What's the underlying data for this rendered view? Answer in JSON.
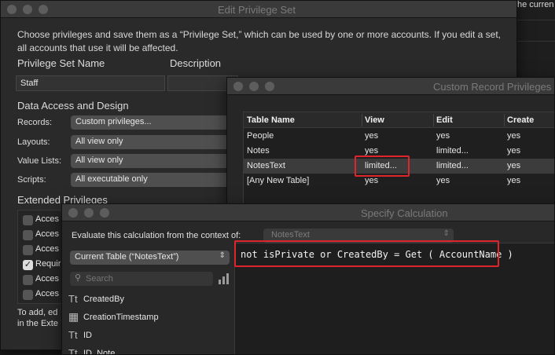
{
  "background": {
    "right_text": "he curren"
  },
  "edit_privilege_set": {
    "title": "Edit Privilege Set",
    "description_text": "Choose privileges and save them as a “Privilege Set,” which can be used by one or more accounts. If you edit a set, all accounts that use it will be affected.",
    "name_label": "Privilege Set Name",
    "name_value": "Staff",
    "description_label": "Description",
    "data_access_heading": "Data Access and Design",
    "records_label": "Records:",
    "records_value": "Custom privileges...",
    "layouts_label": "Layouts:",
    "layouts_value": "All view only",
    "value_lists_label": "Value Lists:",
    "value_lists_value": "All view only",
    "scripts_label": "Scripts:",
    "scripts_value": "All executable only",
    "extended_heading": "Extended Privileges",
    "extended_items": [
      "Acces",
      "Acces",
      "Acces",
      "Requir",
      "Acces",
      "Acces"
    ],
    "footer_text_1": "To add, ed",
    "footer_text_2": "in the Exte"
  },
  "custom_record": {
    "title": "Custom Record Privileges",
    "columns": [
      "Table Name",
      "View",
      "Edit",
      "Create"
    ],
    "rows": [
      [
        "People",
        "yes",
        "yes",
        "yes"
      ],
      [
        "Notes",
        "yes",
        "limited...",
        "yes"
      ],
      [
        "NotesText",
        "limited...",
        "limited...",
        "yes"
      ],
      [
        "[Any New Table]",
        "yes",
        "yes",
        "yes"
      ]
    ]
  },
  "specify_calc": {
    "title": "Specify Calculation",
    "context_label": "Evaluate this calculation from the context of:",
    "context_value": "NotesText",
    "table_popup": "Current Table (“NotesText”)",
    "search_placeholder": "Search",
    "fields": [
      {
        "icon": "text-field-icon",
        "glyph": "Tt",
        "name": "CreatedBy"
      },
      {
        "icon": "timestamp-field-icon",
        "glyph": "▦",
        "name": "CreationTimestamp"
      },
      {
        "icon": "text-field-icon",
        "glyph": "Tt",
        "name": "ID"
      },
      {
        "icon": "text-field-icon",
        "glyph": "Tt",
        "name": "ID_Note"
      }
    ],
    "formula": "not isPrivate or CreatedBy = Get ( AccountName )"
  },
  "colors": {
    "highlight": "#e0242b",
    "selected_row": "#3c3c3c"
  }
}
